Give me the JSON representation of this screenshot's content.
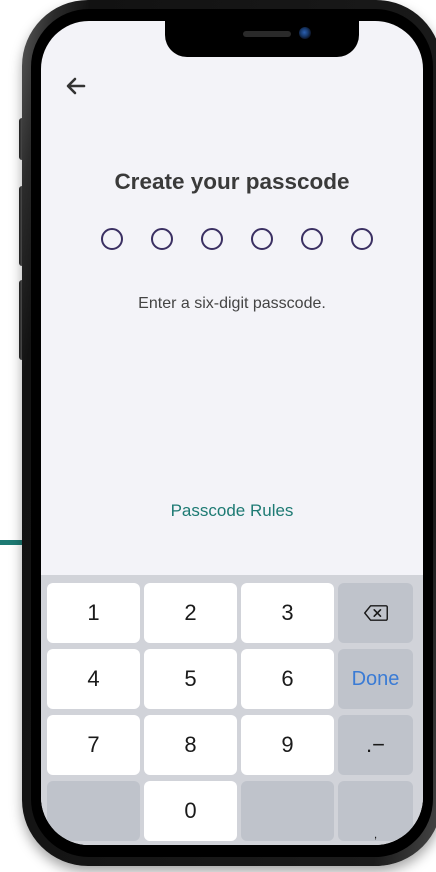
{
  "header": {
    "back_icon": "arrow-left-icon"
  },
  "main": {
    "title": "Create your passcode",
    "passcode_length": 6,
    "passcode_digits_entered": 0,
    "hint": "Enter a six-digit passcode.",
    "rules_link": "Passcode Rules"
  },
  "keyboard": {
    "rows": [
      [
        "1",
        "2",
        "3"
      ],
      [
        "4",
        "5",
        "6"
      ],
      [
        "7",
        "8",
        "9"
      ],
      [
        "",
        "0",
        ""
      ]
    ],
    "side": {
      "backspace_icon": "backspace-icon",
      "done_label": "Done",
      "punct_label": ".−",
      "comma_label": ","
    }
  },
  "colors": {
    "accent": "#1d7a73",
    "circle": "#3a2f62",
    "done": "#3a7bd5",
    "screen_bg": "#f3f3f8"
  }
}
